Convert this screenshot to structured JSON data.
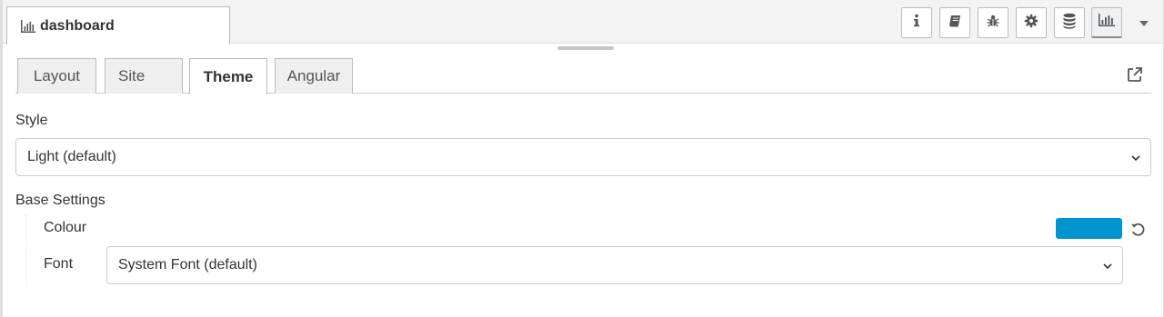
{
  "sidebar": {
    "tab_title": "dashboard",
    "tab_icon": "bar-chart-icon"
  },
  "toolbar": {
    "buttons": [
      {
        "name": "info",
        "icon": "info-icon"
      },
      {
        "name": "help",
        "icon": "book-icon"
      },
      {
        "name": "debug",
        "icon": "bug-icon"
      },
      {
        "name": "config",
        "icon": "gear-icon"
      },
      {
        "name": "context",
        "icon": "database-icon"
      },
      {
        "name": "dashboard",
        "icon": "bar-chart-icon",
        "selected": true
      }
    ],
    "dropdown_icon": "caret-down-icon"
  },
  "tabs": [
    {
      "label": "Layout",
      "active": false
    },
    {
      "label": "Site",
      "active": false
    },
    {
      "label": "Theme",
      "active": true
    },
    {
      "label": "Angular",
      "active": false
    }
  ],
  "theme": {
    "style_label": "Style",
    "style_value": "Light (default)",
    "base_settings_label": "Base Settings",
    "colour_label": "Colour",
    "colour_value": "#0094CE",
    "font_label": "Font",
    "font_value": "System Font (default)"
  }
}
